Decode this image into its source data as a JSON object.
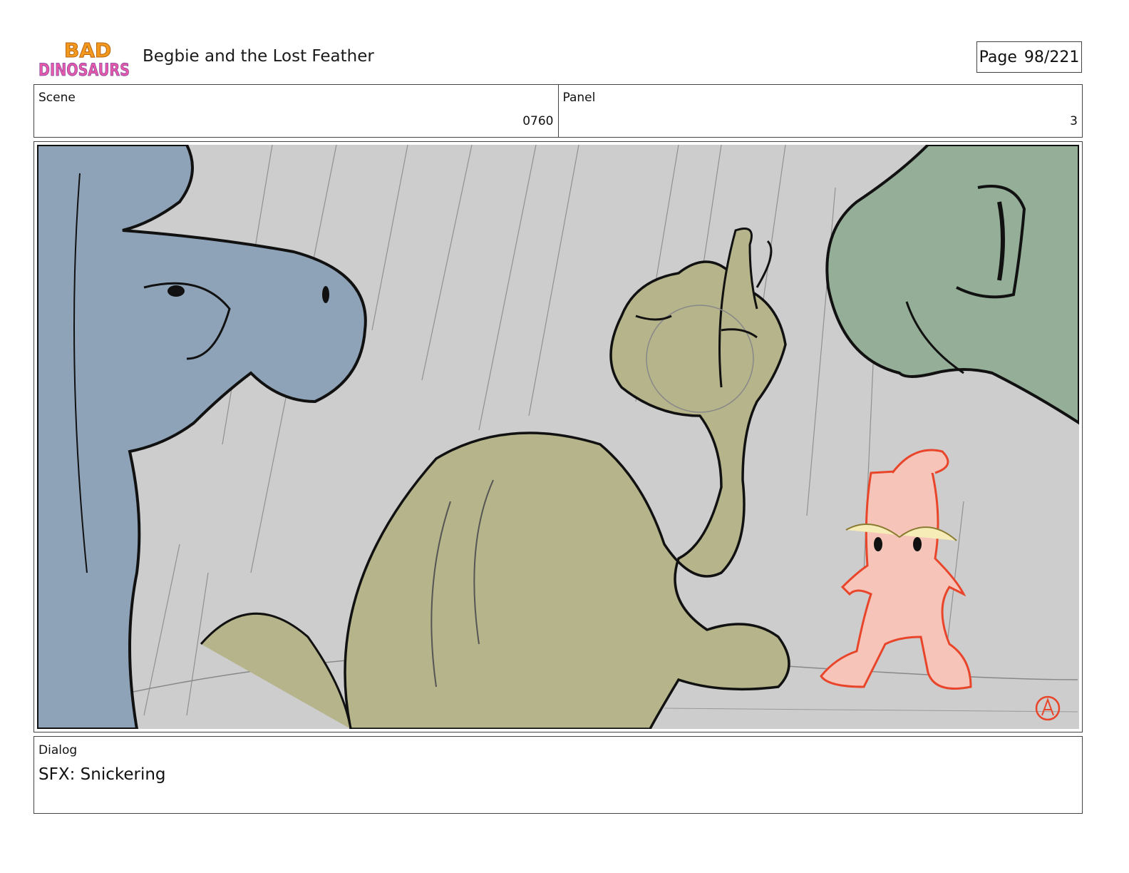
{
  "header": {
    "logo_text_top": "BAD",
    "logo_text_bottom": "DINOSAURS",
    "title": "Begbie and the Lost Feather",
    "page_label": "Page",
    "page_number": "98/221"
  },
  "meta": {
    "scene_label": "Scene",
    "scene_value": "0760",
    "panel_label": "Panel",
    "panel_value": "3"
  },
  "dialog": {
    "label": "Dialog",
    "text": "SFX: Snickering"
  },
  "colors": {
    "background_gray": "#cdcdcd",
    "blue_dino": "#8ea3b8",
    "green_dino": "#94ae98",
    "olive_dino": "#b6b48a",
    "pink_dino": "#f6c4b8",
    "pink_outline": "#e8452a"
  }
}
